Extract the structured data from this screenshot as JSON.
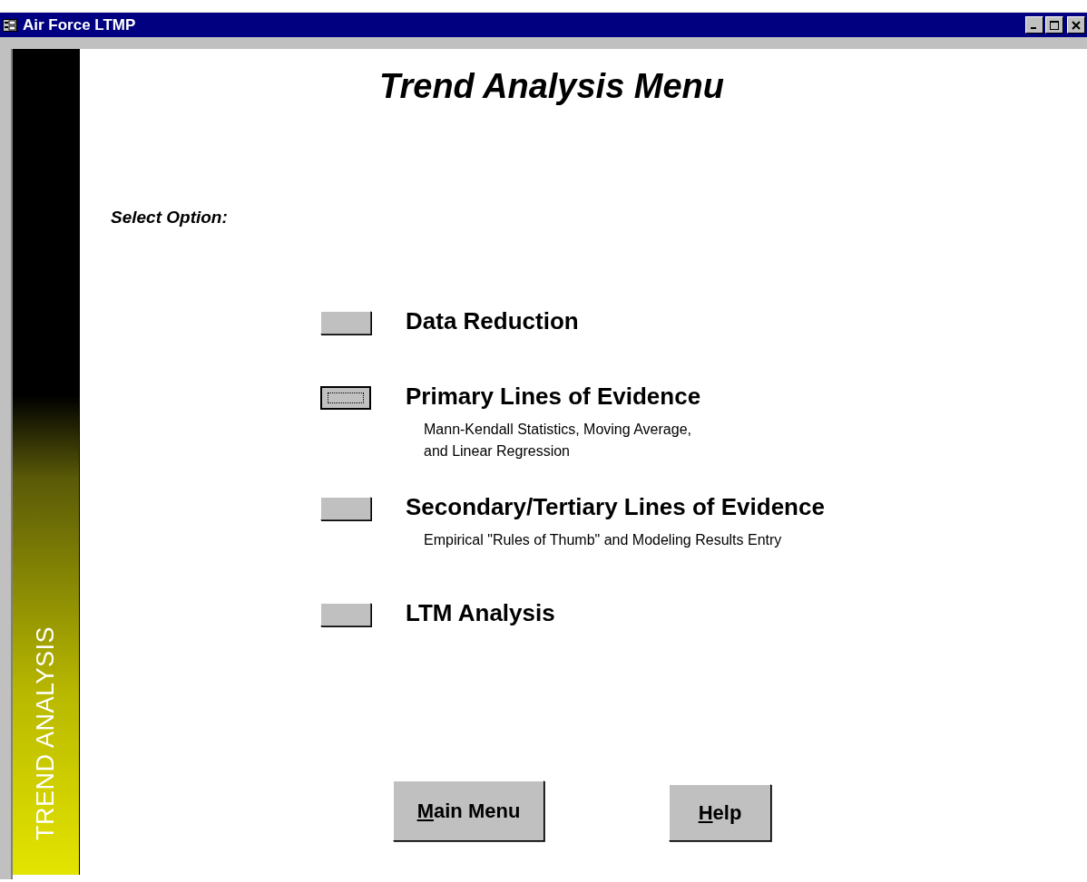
{
  "window": {
    "title": "Air Force LTMP"
  },
  "sidebar": {
    "label": "TREND ANALYSIS"
  },
  "heading": "Trend Analysis Menu",
  "prompt": "Select Option:",
  "options": [
    {
      "label": "Data Reduction",
      "focused": false
    },
    {
      "label": "Primary Lines of Evidence",
      "focused": true,
      "description": "Mann-Kendall Statistics, Moving Average,\nand Linear Regression"
    },
    {
      "label": "Secondary/Tertiary Lines of Evidence",
      "focused": false,
      "description": "Empirical \"Rules of Thumb\" and Modeling Results Entry"
    },
    {
      "label": "LTM Analysis",
      "focused": false
    }
  ],
  "buttons": [
    {
      "label": "Main Menu",
      "first_letter_underlined": true
    },
    {
      "label": "Help",
      "first_letter_underlined": true
    }
  ]
}
